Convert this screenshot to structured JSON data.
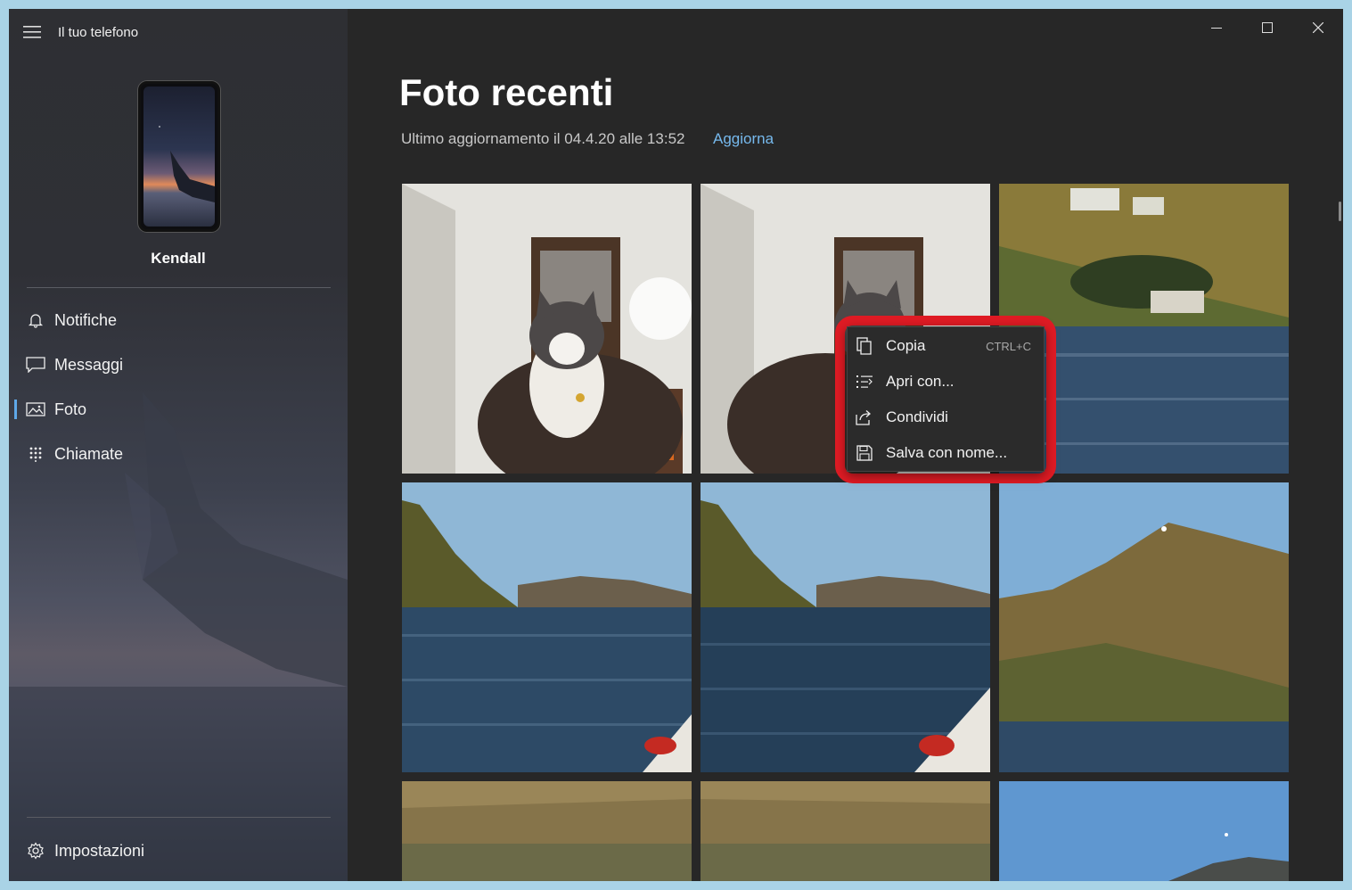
{
  "app": {
    "title": "Il tuo telefono"
  },
  "device": {
    "name": "Kendall"
  },
  "sidebar": {
    "items": [
      {
        "label": "Notifiche",
        "icon": "bell-icon"
      },
      {
        "label": "Messaggi",
        "icon": "message-icon"
      },
      {
        "label": "Foto",
        "icon": "photo-icon",
        "active": true
      },
      {
        "label": "Chiamate",
        "icon": "dialpad-icon"
      }
    ],
    "settings_label": "Impostazioni"
  },
  "main": {
    "title": "Foto recenti",
    "last_update": "Ultimo aggiornamento il 04.4.20 alle 13:52",
    "refresh_label": "Aggiorna"
  },
  "context_menu": {
    "items": [
      {
        "label": "Copia",
        "shortcut": "CTRL+C",
        "icon": "copy-icon"
      },
      {
        "label": "Apri con...",
        "icon": "open-with-icon"
      },
      {
        "label": "Condividi",
        "icon": "share-icon"
      },
      {
        "label": "Salva con nome...",
        "icon": "save-icon"
      }
    ]
  },
  "colors": {
    "accent": "#76b9ed",
    "highlight": "#e01b24",
    "background": "#272727"
  }
}
